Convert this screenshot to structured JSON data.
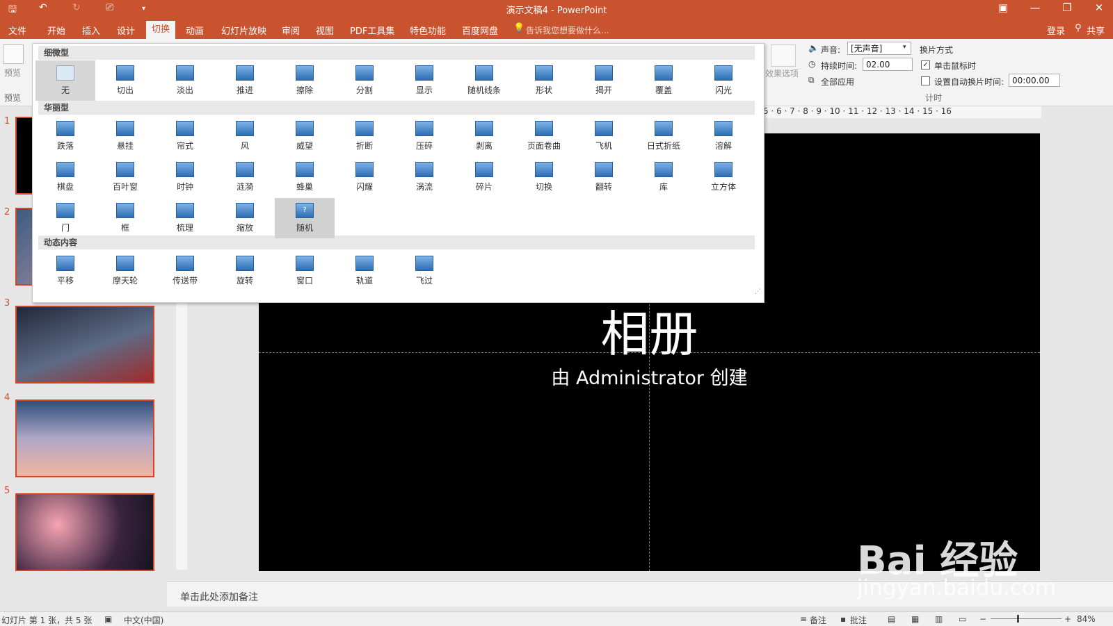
{
  "app": {
    "title": "演示文稿4 - PowerPoint"
  },
  "menu": {
    "tabs": [
      "文件",
      "开始",
      "插入",
      "设计",
      "切换",
      "动画",
      "幻灯片放映",
      "审阅",
      "视图",
      "PDF工具集",
      "特色功能",
      "百度网盘"
    ],
    "active": "切换",
    "tell_me": "告诉我您想要做什么...",
    "login": "登录",
    "share": "共享"
  },
  "ribbon": {
    "preview_label": "预览",
    "preview_group": "预览",
    "effect_options": "效果选项",
    "sound_label": "声音:",
    "sound_value": "[无声音]",
    "duration_label": "持续时间:",
    "duration_value": "02.00",
    "apply_all": "全部应用",
    "advance_title": "换片方式",
    "on_click": "单击鼠标时",
    "on_click_checked": true,
    "after_label": "设置自动换片时间:",
    "after_value": "00:00.00",
    "after_checked": false,
    "timing_group": "计时"
  },
  "gallery": {
    "sections": [
      {
        "title": "细微型",
        "items": [
          "无",
          "切出",
          "淡出",
          "推进",
          "擦除",
          "分割",
          "显示",
          "随机线条",
          "形状",
          "揭开",
          "覆盖",
          "闪光"
        ]
      },
      {
        "title": "华丽型",
        "items": [
          "跌落",
          "悬挂",
          "帘式",
          "风",
          "威望",
          "折断",
          "压碎",
          "剥离",
          "页面卷曲",
          "飞机",
          "日式折纸",
          "溶解",
          "棋盘",
          "百叶窗",
          "时钟",
          "涟漪",
          "蜂巢",
          "闪耀",
          "涡流",
          "碎片",
          "切换",
          "翻转",
          "库",
          "立方体",
          "门",
          "框",
          "梳理",
          "缩放",
          "随机"
        ]
      },
      {
        "title": "动态内容",
        "items": [
          "平移",
          "摩天轮",
          "传送带",
          "旋转",
          "窗口",
          "轨道",
          "飞过"
        ]
      }
    ],
    "selected": "无",
    "hovered": "随机"
  },
  "slides": {
    "numbers": [
      "1",
      "2",
      "3",
      "4",
      "5"
    ],
    "current": 1,
    "total": 5
  },
  "slide": {
    "title": "相册",
    "subtitle": "由 Administrator 创建"
  },
  "ruler": {
    "h": "5 · 6 · 7 · 8 · 9 · 10 · 11 · 12 · 13 · 14 · 15 · 16"
  },
  "notes": {
    "placeholder": "单击此处添加备注"
  },
  "status": {
    "slide_info": "幻灯片 第 1 张，共 5 张",
    "language": "中文(中国)",
    "notes_btn": "备注",
    "comments_btn": "批注",
    "zoom": "84%"
  },
  "watermark": {
    "line1": "Bai 经验",
    "line2": "jingyan.baidu.com"
  },
  "colors": {
    "accent": "#c9532f",
    "slide_bg": "#000000"
  }
}
